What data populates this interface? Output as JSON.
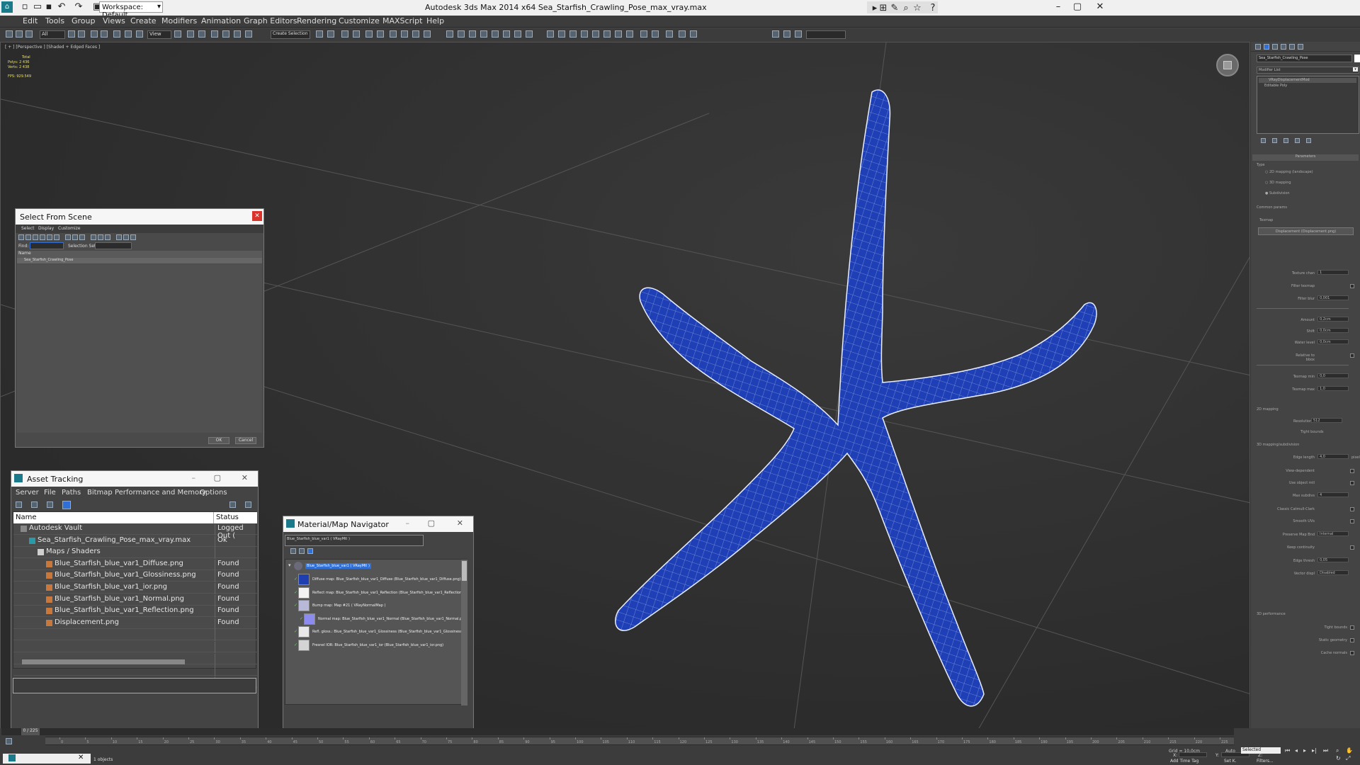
{
  "app": {
    "workspace": "Workspace: Default",
    "title": "Autodesk 3ds Max  2014 x64     Sea_Starfish_Crawling_Pose_max_vray.max"
  },
  "menu": [
    "Edit",
    "Tools",
    "Group",
    "Views",
    "Create",
    "Modifiers",
    "Animation",
    "Graph Editors",
    "Rendering",
    "Customize",
    "MAXScript",
    "Help"
  ],
  "toolbar": {
    "selection_filter": "All",
    "ref_coord": "View",
    "named_selection": "Create Selection"
  },
  "viewport": {
    "label": "[ + ] [Perspective ] [Shaded + Edged Faces ]",
    "stats": {
      "total": "Total",
      "polys": "Polys:  2 436",
      "verts": "Verts:  2 438",
      "fps": "FPS:    929.549"
    }
  },
  "command_panel": {
    "object_name": "Sea_Starfish_Crawling_Pose",
    "modifier_list": "Modifier List",
    "stack": [
      "VRayDisplacementMod",
      "Editable Poly"
    ],
    "rollout_title": "Parameters",
    "type_label": "Type",
    "type_options": [
      "2D mapping (landscape)",
      "3D mapping",
      "Subdivision"
    ],
    "common_params": "Common params",
    "texmap_label": "Texmap",
    "texmap_button": "Displacement (Displacement.png)",
    "fields": [
      {
        "label": "Texture chan",
        "value": "1"
      },
      {
        "label": "Filter texmap",
        "value": ""
      },
      {
        "label": "Filter blur",
        "value": "0,001"
      },
      {
        "label": "Amount",
        "value": "0,2cm"
      },
      {
        "label": "Shift",
        "value": "0,0cm"
      },
      {
        "label": "Water level",
        "value": "0,0cm"
      },
      {
        "label": "Relative to bbox",
        "value": ""
      },
      {
        "label": "Texmap min",
        "value": "0,0"
      },
      {
        "label": "Texmap max",
        "value": "1,0"
      }
    ],
    "mapping2d": "2D mapping",
    "resolution_label": "Resolution",
    "resolution": "512",
    "tight_bounds": "Tight bounds",
    "subdiv_title": "3D mapping/subdivision",
    "subdiv_fields": [
      {
        "label": "Edge length",
        "value": "4,0",
        "unit": "pixels"
      },
      {
        "label": "View-dependent",
        "value": ""
      },
      {
        "label": "Use object mtl",
        "value": ""
      },
      {
        "label": "Max subdivs",
        "value": "4"
      },
      {
        "label": "Classic Catmull-Clark",
        "value": ""
      },
      {
        "label": "Smooth UVs",
        "value": ""
      },
      {
        "label": "Preserve Map Bnd",
        "value": "Internal"
      },
      {
        "label": "Keep continuity",
        "value": ""
      },
      {
        "label": "Edge thresh",
        "value": "0,05"
      },
      {
        "label": "Vector displ",
        "value": "Disabled"
      }
    ],
    "perf_title": "3D performance",
    "perf_fields": [
      "Tight bounds",
      "Static geometry",
      "Cache normals"
    ]
  },
  "select_from_scene": {
    "title": "Select From Scene",
    "menu": [
      "Select",
      "Display",
      "Customize"
    ],
    "find_label": "Find:",
    "selection_set_label": "Selection Set:",
    "column": "Name",
    "items": [
      "Sea_Starfish_Crawling_Pose"
    ],
    "ok": "OK",
    "cancel": "Cancel"
  },
  "asset_tracking": {
    "title": "Asset Tracking",
    "menu": [
      "Server",
      "File",
      "Paths",
      "Bitmap Performance and Memory",
      "Options"
    ],
    "columns": [
      "Name",
      "Status"
    ],
    "rows": [
      {
        "name": "Autodesk Vault",
        "status": "Logged Out (",
        "indent": 0,
        "icon": "vault-icon"
      },
      {
        "name": "Sea_Starfish_Crawling_Pose_max_vray.max",
        "status": "Ok",
        "indent": 1,
        "icon": "max-file-icon"
      },
      {
        "name": "Maps / Shaders",
        "status": "",
        "indent": 2,
        "icon": "folder-icon"
      },
      {
        "name": "Blue_Starfish_blue_var1_Diffuse.png",
        "status": "Found",
        "indent": 3,
        "icon": "image-file-icon"
      },
      {
        "name": "Blue_Starfish_blue_var1_Glossiness.png",
        "status": "Found",
        "indent": 3,
        "icon": "image-file-icon"
      },
      {
        "name": "Blue_Starfish_blue_var1_ior.png",
        "status": "Found",
        "indent": 3,
        "icon": "image-file-icon"
      },
      {
        "name": "Blue_Starfish_blue_var1_Normal.png",
        "status": "Found",
        "indent": 3,
        "icon": "image-file-icon"
      },
      {
        "name": "Blue_Starfish_blue_var1_Reflection.png",
        "status": "Found",
        "indent": 3,
        "icon": "image-file-icon"
      },
      {
        "name": "Displacement.png",
        "status": "Found",
        "indent": 3,
        "icon": "image-file-icon"
      }
    ]
  },
  "material_navigator": {
    "title": "Material/Map Navigator",
    "field": "Blue_Starfish_blue_var1  ( VRayMtl )",
    "root": "Blue_Starfish_blue_var1  ( VRayMtl )",
    "items": [
      {
        "label": "Diffuse map: Blue_Starfish_blue_var1_Diffuse (Blue_Starfish_blue_var1_Diffuse.png)",
        "swatch": "#1f3fb0",
        "indent": 0
      },
      {
        "label": "Reflect map: Blue_Starfish_blue_var1_Reflection (Blue_Starfish_blue_var1_Reflection.p",
        "swatch": "#f2f2f2",
        "indent": 0
      },
      {
        "label": "Bump map: Map #21  ( VRayNormalMap )",
        "swatch": "#b8b8d8",
        "indent": 0
      },
      {
        "label": "Normal map: Blue_Starfish_blue_var1_Normal (Blue_Starfish_blue_var1_Normal.png)",
        "swatch": "#8c8cf0",
        "indent": 1
      },
      {
        "label": "Refl. gloss.: Blue_Starfish_blue_var1_Glossiness (Blue_Starfish_blue_var1_Glossiness.p",
        "swatch": "#e8e8e8",
        "indent": 0
      },
      {
        "label": "Fresnel IOR: Blue_Starfish_blue_var1_ior (Blue_Starfish_blue_var1_ior.png)",
        "swatch": "#d4d4d4",
        "indent": 0
      }
    ]
  },
  "timeline": {
    "frame": "0 / 225",
    "ticks": [
      "0",
      "5",
      "10",
      "15",
      "20",
      "25",
      "30",
      "35",
      "40",
      "45",
      "50",
      "55",
      "60",
      "65",
      "70",
      "75",
      "80",
      "85",
      "90",
      "95",
      "100",
      "105",
      "110",
      "115",
      "120",
      "125",
      "130",
      "135",
      "140",
      "145",
      "150",
      "155",
      "160",
      "165",
      "170",
      "175",
      "180",
      "185",
      "190",
      "195",
      "200",
      "205",
      "210",
      "215",
      "220",
      "225"
    ]
  },
  "status": {
    "objects": "1 objects",
    "grid": "Grid = 10,0cm",
    "auto": "Auto",
    "selected": "Selected",
    "set_k": "Set K.",
    "filters": "Filters...",
    "add_time_tag": "Add Time Tag",
    "x_label": "X:",
    "y_label": "Y:",
    "z_label": "Z:"
  },
  "colors": {
    "starfish": "#1e3fb5",
    "accent": "#2f6fd6",
    "viewport_bg": "#2f2f2f"
  }
}
